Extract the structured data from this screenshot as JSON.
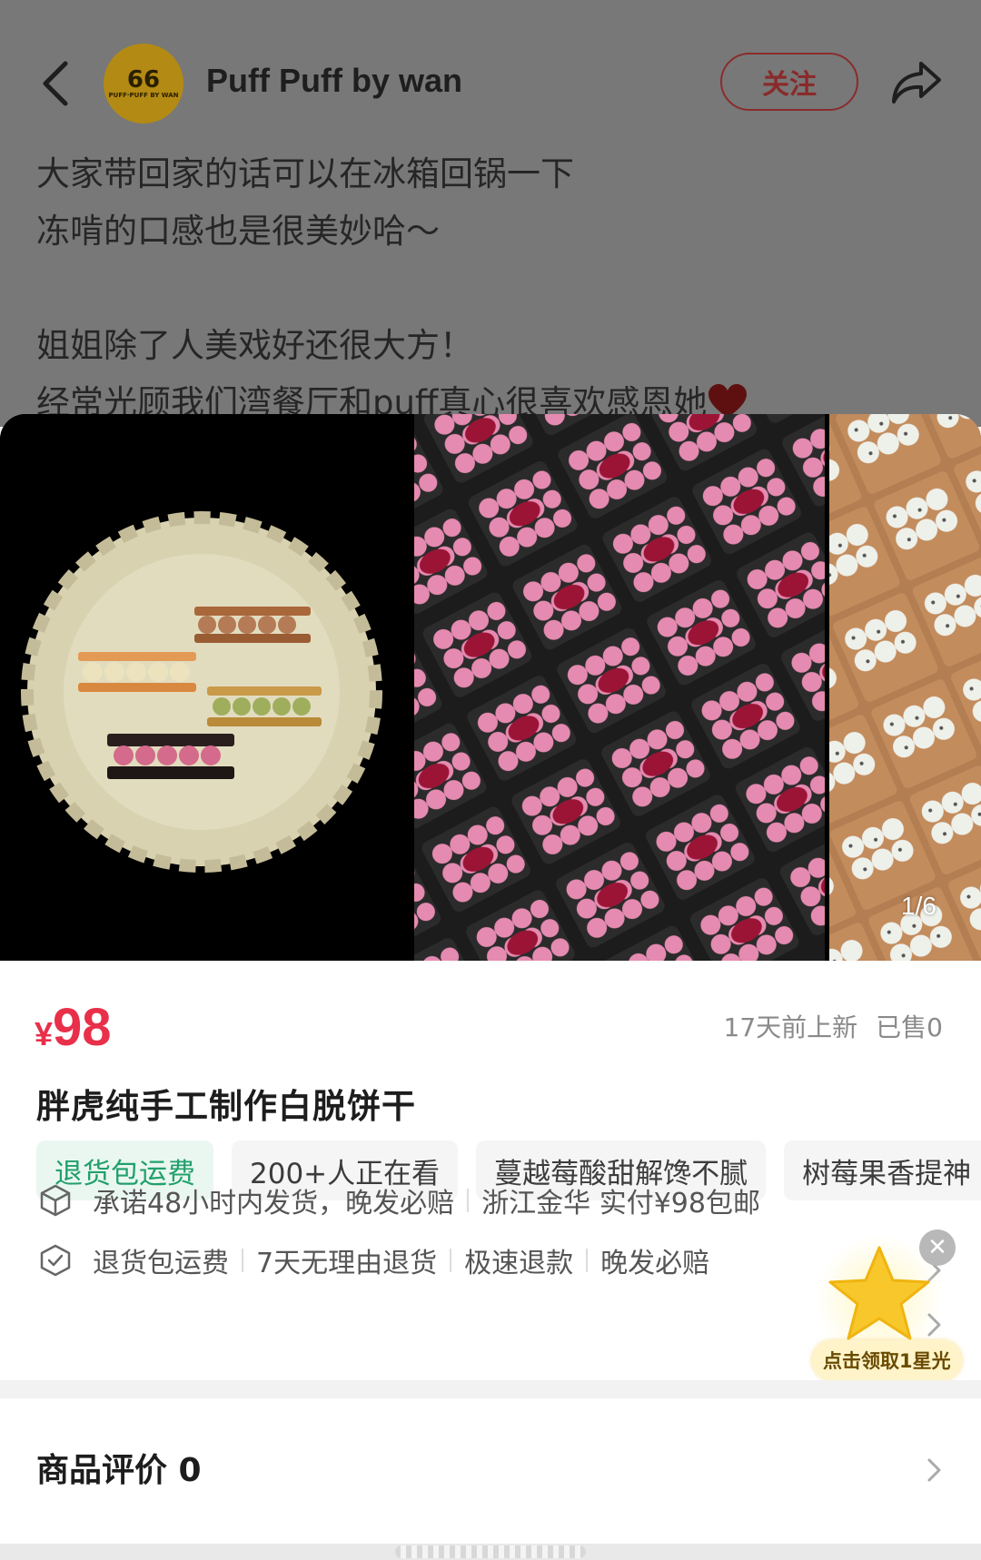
{
  "header": {
    "author_name": "Puff Puff by wan",
    "avatar_text": "66",
    "avatar_subtext": "PUFF·PUFF BY WAN",
    "follow_label": "关注"
  },
  "note": {
    "text": "大家带回家的话可以在冰箱回锅一下\n冻啃的口感也是很美妙哈～\n\n姐姐除了人美戏好还很大方！\n经常光顾我们湾餐厅和puff真心很喜欢感恩她"
  },
  "gallery": {
    "counter": "1/6"
  },
  "product": {
    "currency": "¥",
    "price": "98",
    "listed": "17天前上新",
    "sold": "已售0",
    "title": "胖虎纯手工制作白脱饼干",
    "tags": [
      "退货包运费",
      "200+人正在看",
      "蔓越莓酸甜解馋不腻",
      "树莓果香提神"
    ]
  },
  "services": {
    "shipping": [
      "承诺48小时内发货，晚发必赔",
      "浙江金华 实付¥98包邮"
    ],
    "guarantees": [
      "退货包运费",
      "7天无理由退货",
      "极速退款",
      "晚发必赔"
    ]
  },
  "promo": {
    "label": "点击领取1星光"
  },
  "reviews": {
    "title": "商品评价 0"
  },
  "colors": {
    "price_red": "#e8304a",
    "tag_green": "#22a06b",
    "follow_border": "#8a2c2c"
  }
}
